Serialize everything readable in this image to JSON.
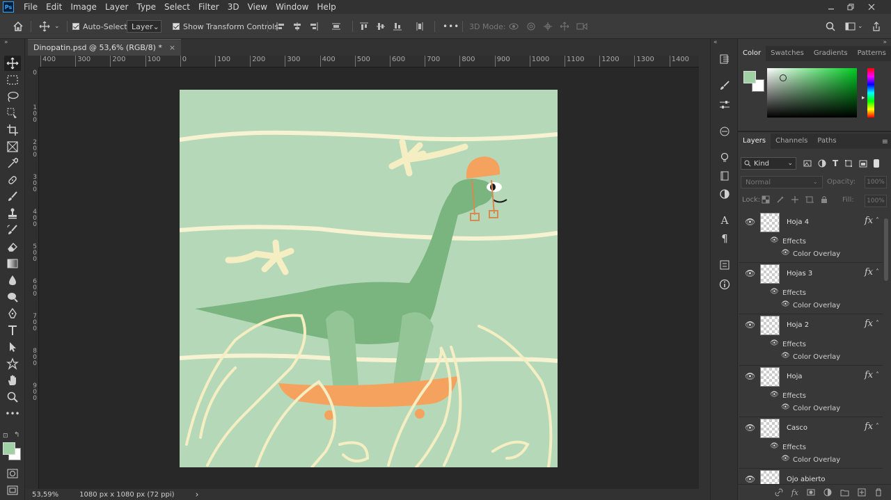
{
  "app": {
    "logo": "Ps"
  },
  "menu": [
    "File",
    "Edit",
    "Image",
    "Layer",
    "Type",
    "Select",
    "Filter",
    "3D",
    "View",
    "Window",
    "Help"
  ],
  "options": {
    "auto_select_label": "Auto-Select:",
    "auto_select_value": "Layer",
    "show_transform_label": "Show Transform Controls",
    "mode_3d_label": "3D Mode:",
    "more": "•••"
  },
  "document": {
    "tab_title": "Dinopatin.psd @ 53,6% (RGB/8) *",
    "close": "×"
  },
  "ruler": {
    "h_ticks": [
      "400",
      "300",
      "200",
      "100",
      "0",
      "100",
      "200",
      "300",
      "400",
      "500",
      "600",
      "700",
      "800",
      "900",
      "1000",
      "1100",
      "1200",
      "1300",
      "1400"
    ],
    "v_ticks": [
      "0",
      "1\n0\n0",
      "2\n0\n0",
      "3\n0\n0",
      "4\n0\n0",
      "5\n0\n0",
      "6\n0\n0",
      "7\n0\n0",
      "8\n0\n0",
      "9\n0\n0"
    ]
  },
  "status": {
    "zoom": "53,59%",
    "size": "1080 px x 1080 px (72 ppi)",
    "arrow": "›"
  },
  "colors": {
    "canvas_bg": "#b5d9b8",
    "dino": "#7ab47f",
    "dino_leg_light": "#93c597",
    "helmet": "#f5a25f",
    "skateboard": "#f5a25f",
    "lines": "#f7f3d2",
    "foreground": "#9fd1a4",
    "background": "#ffffff"
  },
  "color_panel": {
    "tabs": [
      "Color",
      "Swatches",
      "Gradients",
      "Patterns"
    ]
  },
  "layers_panel": {
    "tabs": [
      "Layers",
      "Channels",
      "Paths"
    ],
    "filter_kind": "Kind",
    "blend_mode": "Normal",
    "opacity_label": "Opacity:",
    "opacity_value": "100%",
    "lock_label": "Lock:",
    "fill_label": "Fill:",
    "fill_value": "100%",
    "layers": [
      {
        "name": "Hoja 4",
        "effects": "Effects",
        "effect_item": "Color Overlay",
        "fx": "fx"
      },
      {
        "name": "Hojas 3",
        "effects": "Effects",
        "effect_item": "Color Overlay",
        "fx": "fx"
      },
      {
        "name": "Hoja 2",
        "effects": "Effects",
        "effect_item": "Color Overlay",
        "fx": "fx"
      },
      {
        "name": "Hoja",
        "effects": "Effects",
        "effect_item": "Color Overlay",
        "fx": "fx"
      },
      {
        "name": "Casco",
        "effects": "Effects",
        "effect_item": "Color Overlay",
        "fx": "fx"
      },
      {
        "name": "Ojo abierto"
      }
    ]
  }
}
